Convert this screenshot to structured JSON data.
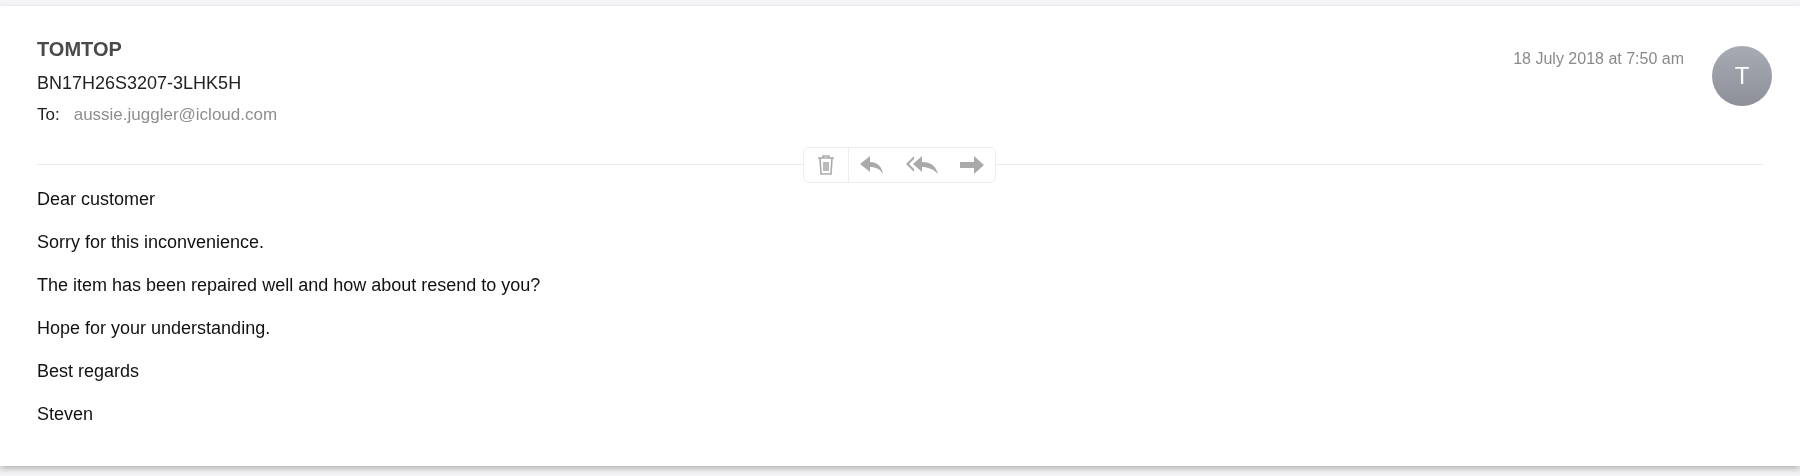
{
  "message": {
    "sender": "TOMTOP",
    "subject": "BN17H26S3207-3LHK5H",
    "to_label": "To:",
    "to_address": "aussie.juggler@icloud.com",
    "date": "18 July 2018 at 7:50 am",
    "avatar_initial": "T"
  },
  "body": [
    "Dear customer",
    "Sorry for this inconvenience.",
    "The item has been repaired well and how about resend to you?",
    "Hope for your understanding.",
    "Best regards",
    "Steven"
  ]
}
